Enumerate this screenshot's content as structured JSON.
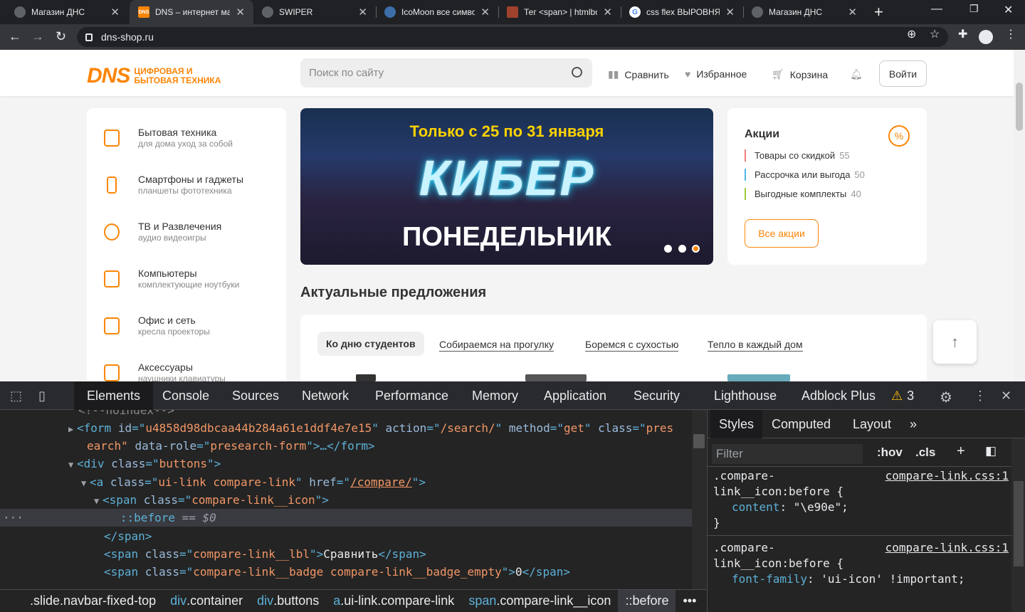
{
  "browser": {
    "tabs": [
      {
        "title": "Магазин ДНС",
        "favicon": "globe"
      },
      {
        "title": "DNS – интернет маг",
        "favicon": "DNS"
      },
      {
        "title": "SWIPER",
        "favicon": "globe"
      },
      {
        "title": "IcoMoon все симво",
        "favicon": "globe"
      },
      {
        "title": "Тег <span> | htmlbo",
        "favicon": "htmlbook"
      },
      {
        "title": "css flex ВЫРОВНЯТЬ",
        "favicon": "google"
      },
      {
        "title": "Магазин ДНС",
        "favicon": "globe"
      }
    ],
    "active_tab": 1,
    "url": "dns-shop.ru"
  },
  "site": {
    "logo_text": "DNS",
    "logo_tagline_1": "ЦИФРОВАЯ И",
    "logo_tagline_2": "БЫТОВАЯ ТЕХНИКА",
    "search_placeholder": "Поиск по сайту",
    "header_links": [
      "Сравнить",
      "Избранное",
      "Корзина"
    ],
    "login_label": "Войти",
    "categories": [
      {
        "title": "Бытовая техника",
        "sub": "для дома   уход за собой"
      },
      {
        "title": "Смартфоны и гаджеты",
        "sub": "планшеты   фототехника"
      },
      {
        "title": "ТВ и Развлечения",
        "sub": "аудио   видеоигры"
      },
      {
        "title": "Компьютеры",
        "sub": "комплектующие   ноутбуки"
      },
      {
        "title": "Офис и сеть",
        "sub": "кресла   проекторы"
      },
      {
        "title": "Аксессуары",
        "sub": "наушники   клавиатуры"
      }
    ],
    "banner": {
      "line1": "Только с 25 по 31 января",
      "line2": "КИБЕР",
      "line3": "ПОНЕДЕЛЬНИК"
    },
    "promo": {
      "title": "Акции",
      "rows": [
        {
          "label": "Товары со скидкой",
          "count": "55",
          "color": "#f07b7b"
        },
        {
          "label": "Рассрочка или выгода",
          "count": "50",
          "color": "#4fb6e6"
        },
        {
          "label": "Выгодные комплекты",
          "count": "40",
          "color": "#9ccc3c"
        }
      ],
      "all_label": "Все акции"
    },
    "section_title": "Актуальные предложения",
    "offer_tabs": [
      "Ко дню студентов",
      "Собираемся на прогулку",
      "Боремся с сухостью",
      "Тепло в каждый дом"
    ],
    "accent": "#fc8507"
  },
  "devtools": {
    "tabs": [
      "Elements",
      "Console",
      "Sources",
      "Network",
      "Performance",
      "Memory",
      "Application",
      "Security",
      "Lighthouse",
      "Adblock Plus"
    ],
    "warnings": "3",
    "style_tabs": [
      "Styles",
      "Computed",
      "Layout"
    ],
    "filter_placeholder": "Filter",
    "filter_buttons": [
      ":hov",
      ".cls"
    ],
    "dom": {
      "comment": "<!--noindex-->",
      "form_tag": "form",
      "form_attrs": [
        {
          "n": "id",
          "v": "u4858d98dbcaa44b284a61e1ddf4e7e15"
        },
        {
          "n": "action",
          "v": "/search/"
        },
        {
          "n": "method",
          "v": "get"
        },
        {
          "n": "class",
          "v": "pres"
        }
      ],
      "form_cont": "earch\"",
      "form_role_n": "data-role",
      "form_role_v": "presearch-form",
      "form_end": ">…</form>",
      "div_class": "buttons",
      "a_class": "ui-link compare-link",
      "a_href": "/compare/",
      "span_class": "compare-link__icon",
      "before": "::before",
      "before_eq": " == ",
      "before_var": "$0",
      "span_close": "</span>",
      "lbl_class": "compare-link__lbl",
      "lbl_text": "Сравнить",
      "badge_class": "compare-link__badge compare-link__badge_empty",
      "badge_text": "0"
    },
    "breadcrumbs": [
      {
        "tag": "",
        "cls": ".slide.navbar-fixed-top"
      },
      {
        "tag": "div",
        "cls": ".container"
      },
      {
        "tag": "div",
        "cls": ".buttons"
      },
      {
        "tag": "a",
        "cls": ".ui-link.compare-link"
      },
      {
        "tag": "span",
        "cls": ".compare-link__icon"
      },
      {
        "tag": "",
        "cls": "::before"
      }
    ],
    "rules": [
      {
        "sel1": ".compare-",
        "sel2": "link__icon:before {",
        "src": "compare-link.css:1",
        "prop": "content",
        "val": "\"\\e90e\";"
      },
      {
        "sel1": ".compare-",
        "sel2": "link__icon:before {",
        "src": "compare-link.css:1",
        "prop": "font-family",
        "val": "'ui-icon' !important;"
      }
    ]
  }
}
